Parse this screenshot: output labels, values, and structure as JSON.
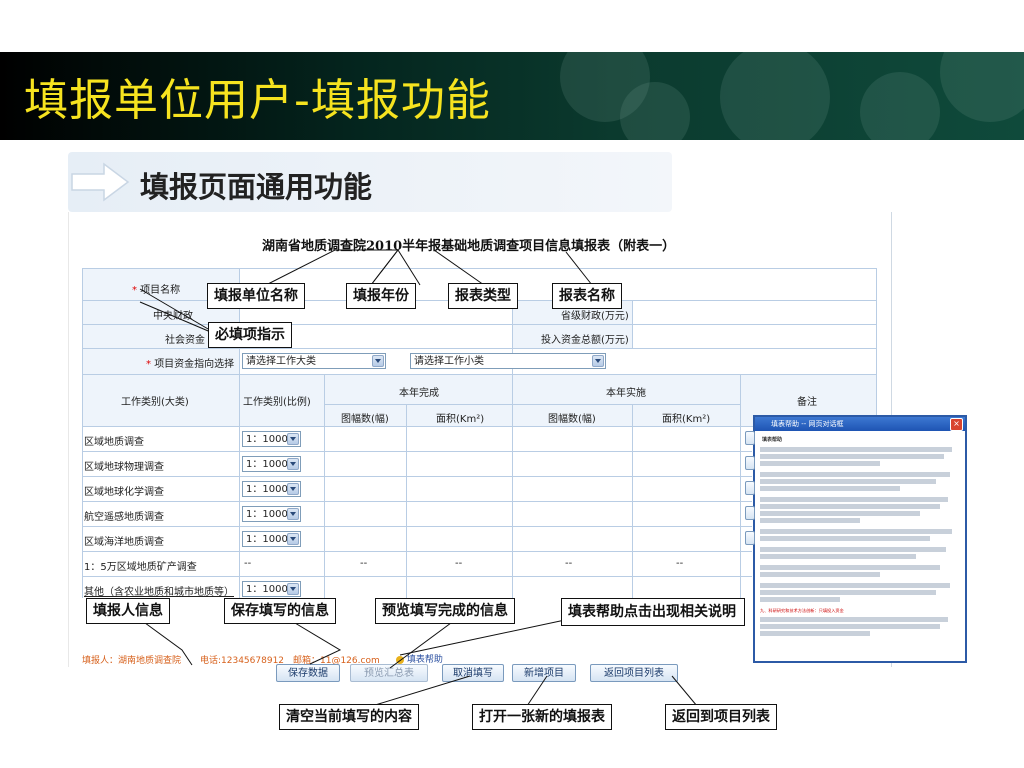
{
  "slide": {
    "header_title": "填报单位用户-填报功能",
    "section_title": "填报页面通用功能"
  },
  "form": {
    "title": "湖南省地质调查院2010半年报基础地质调查项目信息填报表（附表一）",
    "project_name_label": "项目名称",
    "central_finance_label": "中央财政",
    "provincial_finance_label": "省级财政(万元)",
    "social_funds_label": "社会资金",
    "total_investment_label": "投入资金总额(万元)",
    "fund_direction_label": "项目资金指向选择",
    "work_category_major_select": "请选择工作大类",
    "work_category_minor_select": "请选择工作小类",
    "columns": {
      "work_category_major": "工作类别(大类)",
      "work_category_scale": "工作类别(比例)",
      "completed_this_year": "本年完成",
      "implemented_this_year": "本年实施",
      "remarks": "备注",
      "sheets": "图幅数(幅)",
      "area": "面积(Km²)"
    },
    "rows": [
      {
        "name": "区域地质调查",
        "scale": "1：1000"
      },
      {
        "name": "区域地球物理调查",
        "scale": "1：1000"
      },
      {
        "name": "区域地球化学调查",
        "scale": "1：1000"
      },
      {
        "name": "航空遥感地质调查",
        "scale": "1：1000"
      },
      {
        "name": "区域海洋地质调查",
        "scale": "1：1000"
      },
      {
        "name": "1：5万区域地质矿产调查",
        "scale": "--",
        "dash": "--"
      },
      {
        "name": "其他（含农业地质和城市地质等）",
        "scale": "1：1000"
      }
    ],
    "reporter_info": "填报人：湖南地质调查院",
    "phone_info": "电话:12345678912",
    "email_info": "邮箱：11@126.com",
    "help_link": "填表帮助",
    "buttons": {
      "save": "保存数据",
      "preview": "预览汇总表",
      "cancel": "取消填写",
      "new_project": "新增项目",
      "back_to_list": "返回项目列表"
    }
  },
  "callouts": {
    "unit_name": "填报单位名称",
    "report_year": "填报年份",
    "report_type": "报表类型",
    "report_name": "报表名称",
    "required_indicator": "必填项指示",
    "reporter_info": "填报人信息",
    "save_info": "保存填写的信息",
    "preview_info": "预览填写完成的信息",
    "help_info": "填表帮助点击出现相关说明",
    "clear_info": "清空当前填写的内容",
    "new_form": "打开一张新的填报表",
    "back_list": "返回到项目列表"
  },
  "popup": {
    "title": "填表帮助 -- 网页对话框",
    "heading": "填表帮助",
    "note": "九、科研研究和技术方法创新：只填投入资金"
  },
  "colors": {
    "header_title": "#f6e31f",
    "bottom_info": "#d7611c",
    "grid": "#b9cde4"
  }
}
